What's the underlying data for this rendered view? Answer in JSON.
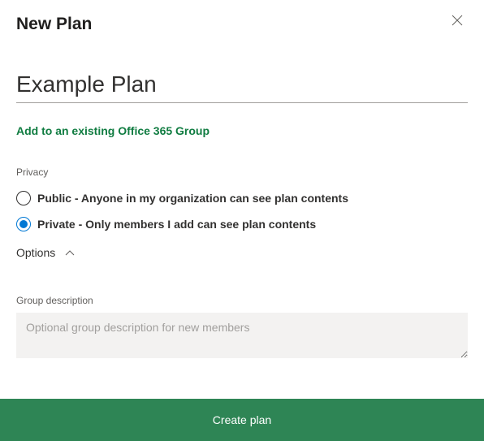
{
  "header": {
    "title": "New Plan"
  },
  "plan_name": {
    "value": "Example Plan"
  },
  "link": {
    "add_group": "Add to an existing Office 365 Group"
  },
  "privacy": {
    "label": "Privacy",
    "options": {
      "public": "Public - Anyone in my organization can see plan contents",
      "private": "Private - Only members I add can see plan contents"
    },
    "selected": "private"
  },
  "options_toggle": {
    "label": "Options"
  },
  "group_description": {
    "label": "Group description",
    "placeholder": "Optional group description for new members",
    "value": ""
  },
  "create_button": {
    "label": "Create plan"
  }
}
